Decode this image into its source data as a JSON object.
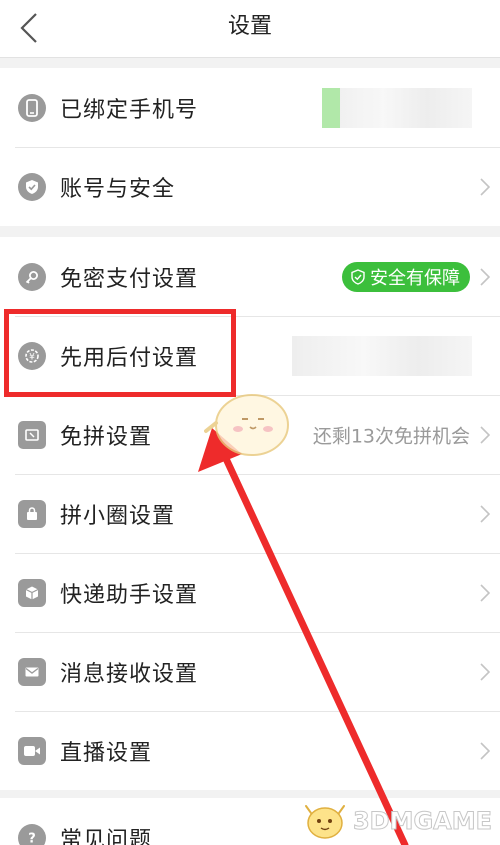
{
  "header": {
    "title": "设置"
  },
  "groups": [
    {
      "items": [
        {
          "label": "已绑定手机号",
          "icon": "phone-icon"
        },
        {
          "label": "账号与安全",
          "icon": "shield-icon"
        }
      ]
    },
    {
      "items": [
        {
          "label": "免密支付设置",
          "icon": "key-icon",
          "badge": "安全有保障"
        },
        {
          "label": "先用后付设置",
          "icon": "pay-later-icon"
        },
        {
          "label": "免拼设置",
          "icon": "coupon-icon",
          "hint": "还剩13次免拼机会"
        },
        {
          "label": "拼小圈设置",
          "icon": "bag-icon"
        },
        {
          "label": "快递助手设置",
          "icon": "package-icon"
        },
        {
          "label": "消息接收设置",
          "icon": "mail-icon"
        },
        {
          "label": "直播设置",
          "icon": "video-icon"
        }
      ]
    },
    {
      "items": [
        {
          "label": "常见问题",
          "icon": "question-icon"
        }
      ]
    }
  ],
  "watermark": {
    "text": "3DMGAME"
  },
  "colors": {
    "badge_green": "#3cbf3c",
    "highlight_red": "#ee2b2b",
    "icon_gray": "#9a9a9a"
  }
}
